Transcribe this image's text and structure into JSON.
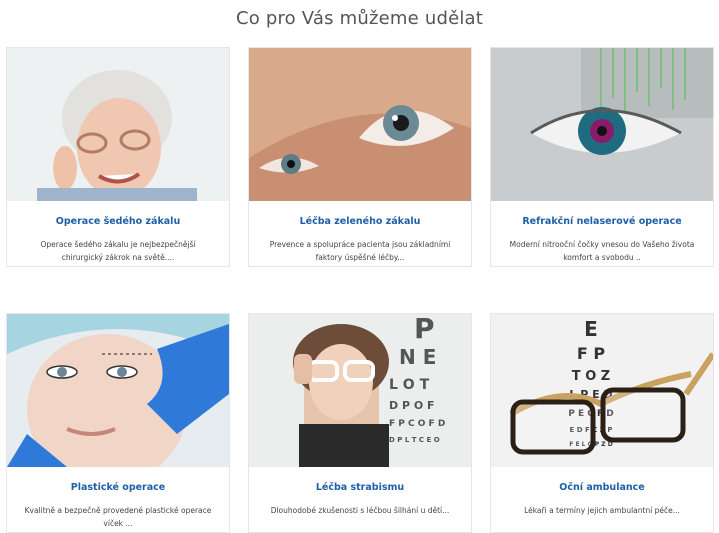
{
  "section": {
    "title": "Co pro Vás můžeme udělat"
  },
  "cards": [
    {
      "title": "Operace šedého zákalu",
      "desc": "Operace šedého zákalu je nejbezpečnější chirurgický zákrok na světě...."
    },
    {
      "title": "Léčba zeleného zákalu",
      "desc": "Prevence a spolupráce pacienta jsou základními faktory úspěšné léčby..."
    },
    {
      "title": "Refrakční nelaserové operace",
      "desc": "Moderní nitrooční čočky vnesou do Vašeho života komfort a svobodu .."
    },
    {
      "title": "Plastické operace",
      "desc": "Kvalitně a bezpečně provedené plastické operace víček ..."
    },
    {
      "title": "Léčba strabismu",
      "desc": "Dlouhodobé zkušenosti s léčbou šilhání u dětí..."
    },
    {
      "title": "Oční ambulance",
      "desc": "Lékaři a termíny jejich ambulantní péče..."
    }
  ],
  "colors": {
    "link": "#1e5fa8",
    "text": "#444444",
    "title": "#555555"
  }
}
